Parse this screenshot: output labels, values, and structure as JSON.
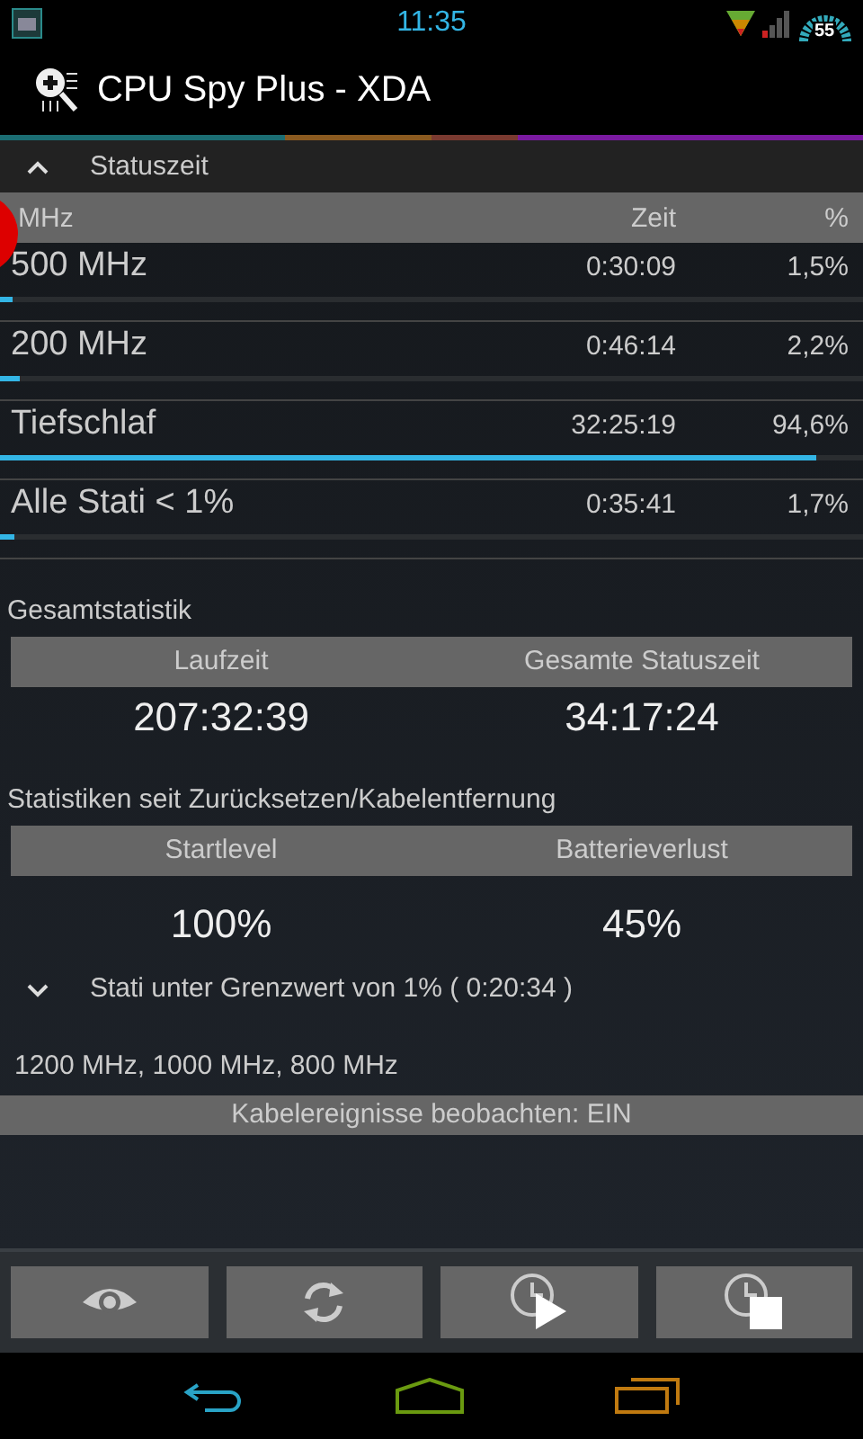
{
  "status_bar": {
    "time": "11:35",
    "battery": "55"
  },
  "app_bar": {
    "title": "CPU Spy Plus - XDA"
  },
  "state_section": {
    "title": "Statuszeit",
    "expanded": true,
    "columns": [
      "MHz",
      "Zeit",
      "%"
    ],
    "rows": [
      {
        "state": "500 MHz",
        "time": "0:30:09",
        "percent": "1,5%",
        "level": 0.015
      },
      {
        "state": "200 MHz",
        "time": "0:46:14",
        "percent": "2,2%",
        "level": 0.022
      },
      {
        "state": "Tiefschlaf",
        "time": "32:25:19",
        "percent": "94,6%",
        "level": 0.946
      },
      {
        "state": "Alle Stati < 1%",
        "time": "0:35:41",
        "percent": "1,7%",
        "level": 0.017
      }
    ]
  },
  "total_stats": {
    "title": "Gesamtstatistik",
    "columns": [
      {
        "label": "Laufzeit",
        "value": "207:32:39"
      },
      {
        "label": "Gesamte Statuszeit",
        "value": "34:17:24"
      }
    ]
  },
  "reset_stats": {
    "title": "Statistiken seit Zurücksetzen/Kabelentfernung",
    "columns": [
      {
        "label": "Startlevel",
        "value": "100%"
      },
      {
        "label": "Batterieverlust",
        "value": "45%"
      }
    ]
  },
  "below_threshold": {
    "title": "Stati unter Grenzwert von 1% ( 0:20:34 )",
    "expanded": false,
    "content": "1200 MHz, 1000 MHz, 800 MHz"
  },
  "cable_events": "Kabelereignisse beobachten: EIN",
  "toolbar": [
    {
      "kind": "eye"
    },
    {
      "kind": "refresh"
    },
    {
      "kind": "timer-start"
    },
    {
      "kind": "timer-stop"
    }
  ]
}
